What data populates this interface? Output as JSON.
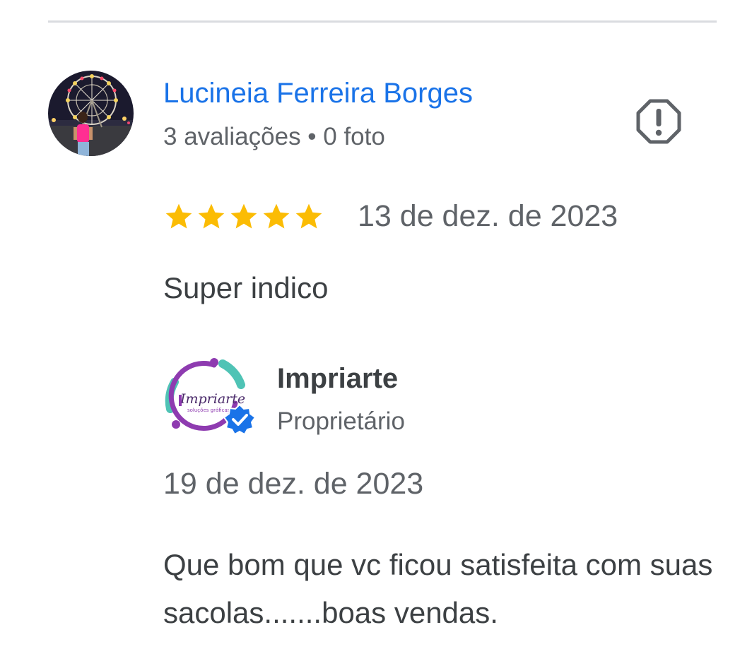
{
  "review": {
    "reviewer_name": "Lucineia Ferreira Borges",
    "reviewer_meta": "3 avaliações • 0 foto",
    "rating": 5,
    "rating_max": 5,
    "date": "13 de dez. de 2023",
    "text": "Super indico",
    "avatar_icon": "ferris-wheel-photo-avatar",
    "report_icon": "report-octagon-exclamation-icon"
  },
  "reply": {
    "owner_name": "Impriarte",
    "logo_text": "Impriarte",
    "logo_tagline": "soluções gráficas",
    "owner_role": "Proprietário",
    "verified_icon": "verified-badge-icon",
    "date": "19 de dez. de 2023",
    "text": "Que bom que vc ficou satisfeita com suas sacolas.......boas vendas."
  },
  "colors": {
    "name_link": "#1a73e8",
    "star": "#fbbc04",
    "secondary_text": "#5f6368",
    "primary_text": "#3c4043",
    "divider": "#dadce0",
    "verified_badge": "#1a73e8",
    "logo_purple": "#8e3bb0",
    "logo_teal": "#4fc3b5"
  }
}
